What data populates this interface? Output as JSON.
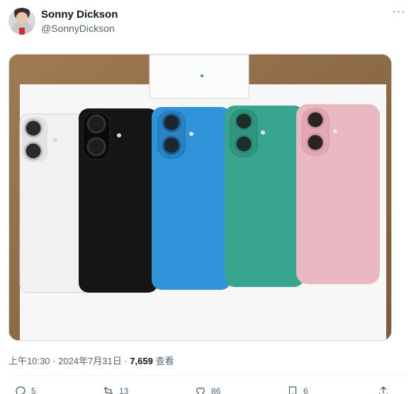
{
  "author": {
    "name": "Sonny Dickson",
    "handle": "@SonnyDickson"
  },
  "more_label": "···",
  "photo": {
    "phone_colors": [
      "#f1f1f1",
      "#151515",
      "#2e93d8",
      "#3aa58f",
      "#eab8c2"
    ],
    "background_color": "#8b6a48"
  },
  "meta": {
    "time": "上午10:30",
    "separator1": " · ",
    "date": "2024年7月31日",
    "separator2": " · ",
    "views_count": "7,659",
    "views_label": " 查看"
  },
  "actions": {
    "reply_count": "5",
    "repost_count": "13",
    "like_count": "86",
    "bookmark_count": "6"
  },
  "icons": {
    "reply": "reply-icon",
    "repost": "repost-icon",
    "like": "heart-icon",
    "bookmark": "bookmark-icon",
    "share": "share-icon"
  }
}
